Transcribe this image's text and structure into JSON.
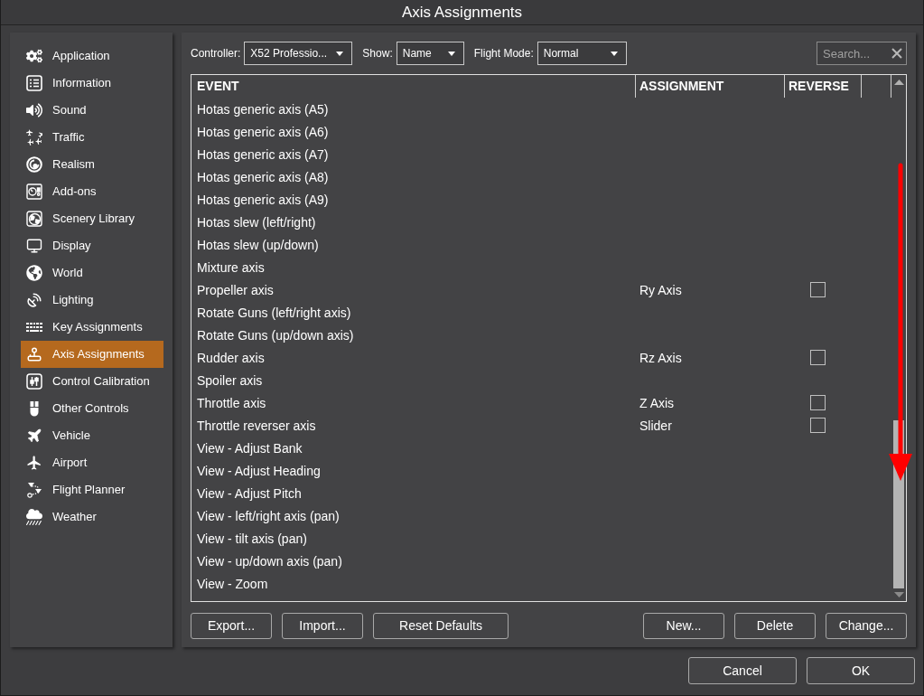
{
  "window": {
    "title": "Axis Assignments"
  },
  "sidebar": {
    "items": [
      {
        "label": "Application",
        "selected": false
      },
      {
        "label": "Information",
        "selected": false
      },
      {
        "label": "Sound",
        "selected": false
      },
      {
        "label": "Traffic",
        "selected": false
      },
      {
        "label": "Realism",
        "selected": false
      },
      {
        "label": "Add-ons",
        "selected": false
      },
      {
        "label": "Scenery Library",
        "selected": false
      },
      {
        "label": "Display",
        "selected": false
      },
      {
        "label": "World",
        "selected": false
      },
      {
        "label": "Lighting",
        "selected": false
      },
      {
        "label": "Key Assignments",
        "selected": false
      },
      {
        "label": "Axis Assignments",
        "selected": true
      },
      {
        "label": "Control Calibration",
        "selected": false
      },
      {
        "label": "Other Controls",
        "selected": false
      },
      {
        "label": "Vehicle",
        "selected": false
      },
      {
        "label": "Airport",
        "selected": false
      },
      {
        "label": "Flight Planner",
        "selected": false
      },
      {
        "label": "Weather",
        "selected": false
      }
    ]
  },
  "toolbar": {
    "controller": {
      "label": "Controller:",
      "value": "X52 Professio..."
    },
    "show": {
      "label": "Show:",
      "value": "Name"
    },
    "flight_mode": {
      "label": "Flight Mode:",
      "value": "Normal"
    },
    "search": {
      "placeholder": "Search..."
    }
  },
  "table": {
    "columns": [
      "EVENT",
      "ASSIGNMENT",
      "REVERSE"
    ],
    "rows": [
      {
        "event": "Hotas generic axis (A5)"
      },
      {
        "event": "Hotas generic axis (A6)"
      },
      {
        "event": "Hotas generic axis (A7)"
      },
      {
        "event": "Hotas generic axis (A8)"
      },
      {
        "event": "Hotas generic axis (A9)"
      },
      {
        "event": "Hotas slew (left/right)"
      },
      {
        "event": "Hotas slew (up/down)"
      },
      {
        "event": "Mixture axis"
      },
      {
        "event": "Propeller axis",
        "assignment": "Ry Axis",
        "reverse": false
      },
      {
        "event": "Rotate Guns (left/right axis)"
      },
      {
        "event": "Rotate Guns (up/down axis)"
      },
      {
        "event": "Rudder axis",
        "assignment": "Rz Axis",
        "reverse": false
      },
      {
        "event": "Spoiler axis"
      },
      {
        "event": "Throttle axis",
        "assignment": "Z Axis",
        "reverse": false
      },
      {
        "event": "Throttle reverser axis",
        "assignment": "Slider",
        "reverse": false
      },
      {
        "event": "View - Adjust Bank"
      },
      {
        "event": "View - Adjust Heading"
      },
      {
        "event": "View - Adjust Pitch"
      },
      {
        "event": "View - left/right axis (pan)"
      },
      {
        "event": "View - tilt axis (pan)"
      },
      {
        "event": "View - up/down axis (pan)"
      },
      {
        "event": "View - Zoom"
      }
    ]
  },
  "table_actions_left": [
    "Export...",
    "Import...",
    "Reset Defaults"
  ],
  "table_actions_right": [
    "New...",
    "Delete",
    "Change..."
  ],
  "dialog_buttons": [
    "Cancel",
    "OK"
  ]
}
